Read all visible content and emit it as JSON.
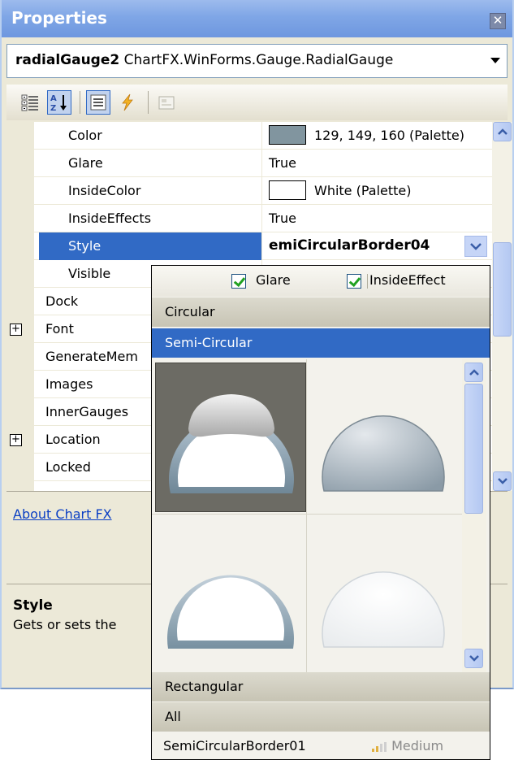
{
  "window": {
    "title": "Properties"
  },
  "object_selector": {
    "name": "radialGauge2",
    "type": "ChartFX.WinForms.Gauge.RadialGauge"
  },
  "toolbar": {
    "buttons": [
      {
        "icon": "categorized-icon",
        "tooltip": ""
      },
      {
        "icon": "alphabetical-icon",
        "tooltip": ""
      },
      {
        "icon": "properties-icon",
        "tooltip": ""
      },
      {
        "icon": "events-lightning-icon",
        "tooltip": ""
      },
      {
        "icon": "property-pages-icon",
        "tooltip": ""
      }
    ]
  },
  "grid": {
    "rows": [
      {
        "name": "Color",
        "value": "129, 149, 160 (Palette)",
        "swatch": "#81959f"
      },
      {
        "name": "Glare",
        "value": "True"
      },
      {
        "name": "InsideColor",
        "value": "White (Palette)",
        "swatch": "#ffffff"
      },
      {
        "name": "InsideEffects",
        "value": "True"
      },
      {
        "name": "Style",
        "value": "emiCircularBorder04"
      },
      {
        "name": "Visible",
        "value": ""
      },
      {
        "name": "Dock",
        "value": ""
      },
      {
        "name": "Font",
        "value": ""
      },
      {
        "name": "GenerateMem",
        "value": ""
      },
      {
        "name": "Images",
        "value": ""
      },
      {
        "name": "InnerGauges",
        "value": ""
      },
      {
        "name": "Location",
        "value": ""
      },
      {
        "name": "Locked",
        "value": ""
      }
    ]
  },
  "link": {
    "text": "About Chart FX"
  },
  "description": {
    "title": "Style",
    "text": "Gets or sets the"
  },
  "dropdown": {
    "options": {
      "glare_label": "Glare",
      "glare_checked": true,
      "inside_label": "InsideEffect",
      "inside_checked": true
    },
    "categories_top": [
      "Circular",
      "Semi-Circular"
    ],
    "categories_bottom": [
      "Rectangular",
      "All"
    ],
    "selected_category": "Semi-Circular",
    "gallery": [
      {
        "style": "dark-glare",
        "selected": true
      },
      {
        "style": "gray-dome",
        "selected": false
      },
      {
        "style": "ring-white",
        "selected": false
      },
      {
        "style": "plain-white",
        "selected": false
      }
    ],
    "selected_item": {
      "name": "SemiCircularBorder01",
      "level": "Medium"
    }
  },
  "colors": {
    "selection": "#316ac5",
    "chrome": "#ece9d8",
    "title_bar": "#7fa6e6"
  }
}
